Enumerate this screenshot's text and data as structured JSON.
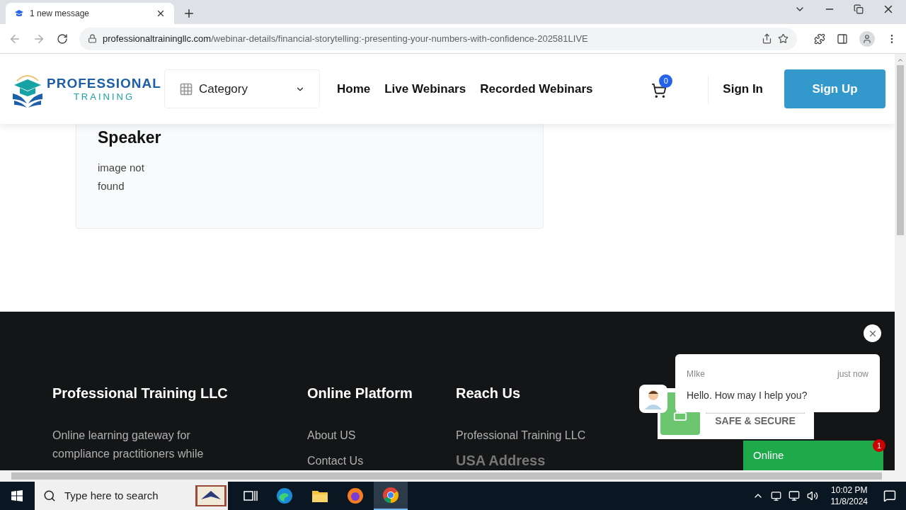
{
  "browser": {
    "tab_title": "1 new message",
    "url_domain": "professionaltrainingllc.com",
    "url_path": "/webinar-details/financial-storytelling:-presenting-your-numbers-with-confidence-202581LIVE"
  },
  "header": {
    "logo_top": "PROFESSIONAL",
    "logo_bottom": "TRAINING",
    "category": "Category",
    "nav": [
      "Home",
      "Live Webinars",
      "Recorded Webinars"
    ],
    "cart_count": "0",
    "sign_in": "Sign In",
    "sign_up": "Sign Up"
  },
  "speaker_card": {
    "heading": "Speaker",
    "image_alt": "image not found"
  },
  "footer": {
    "columns": [
      {
        "title": "Professional Training LLC",
        "description": "Online learning gateway for compliance practitioners while"
      },
      {
        "title": "Online Platform",
        "links": [
          "About US",
          "Contact Us"
        ]
      },
      {
        "title": "Reach Us",
        "links": [
          "Professional Training LLC"
        ],
        "subheading": "USA Address"
      }
    ]
  },
  "chat": {
    "name": "MIke",
    "time": "just now",
    "message": "Hello. How may I help you?"
  },
  "secure_badge": {
    "text": "SAFE & SECURE"
  },
  "online_button": {
    "label": "Online",
    "count": "1"
  },
  "taskbar": {
    "search_placeholder": "Type here to search",
    "time": "10:02 PM",
    "date": "11/8/2024"
  }
}
